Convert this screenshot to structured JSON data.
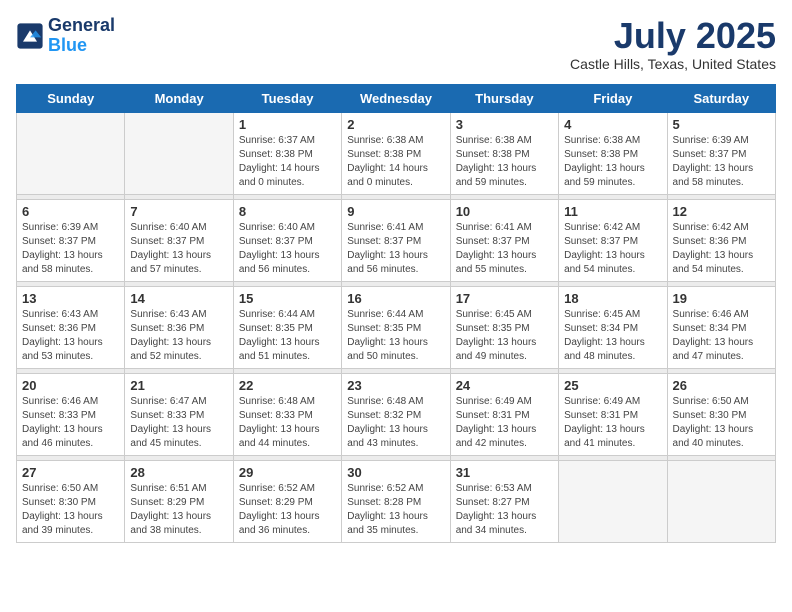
{
  "header": {
    "logo_line1": "General",
    "logo_line2": "Blue",
    "month_title": "July 2025",
    "location": "Castle Hills, Texas, United States"
  },
  "weekdays": [
    "Sunday",
    "Monday",
    "Tuesday",
    "Wednesday",
    "Thursday",
    "Friday",
    "Saturday"
  ],
  "weeks": [
    [
      {
        "day": "",
        "info": ""
      },
      {
        "day": "",
        "info": ""
      },
      {
        "day": "1",
        "info": "Sunrise: 6:37 AM\nSunset: 8:38 PM\nDaylight: 14 hours\nand 0 minutes."
      },
      {
        "day": "2",
        "info": "Sunrise: 6:38 AM\nSunset: 8:38 PM\nDaylight: 14 hours\nand 0 minutes."
      },
      {
        "day": "3",
        "info": "Sunrise: 6:38 AM\nSunset: 8:38 PM\nDaylight: 13 hours\nand 59 minutes."
      },
      {
        "day": "4",
        "info": "Sunrise: 6:38 AM\nSunset: 8:38 PM\nDaylight: 13 hours\nand 59 minutes."
      },
      {
        "day": "5",
        "info": "Sunrise: 6:39 AM\nSunset: 8:37 PM\nDaylight: 13 hours\nand 58 minutes."
      }
    ],
    [
      {
        "day": "6",
        "info": "Sunrise: 6:39 AM\nSunset: 8:37 PM\nDaylight: 13 hours\nand 58 minutes."
      },
      {
        "day": "7",
        "info": "Sunrise: 6:40 AM\nSunset: 8:37 PM\nDaylight: 13 hours\nand 57 minutes."
      },
      {
        "day": "8",
        "info": "Sunrise: 6:40 AM\nSunset: 8:37 PM\nDaylight: 13 hours\nand 56 minutes."
      },
      {
        "day": "9",
        "info": "Sunrise: 6:41 AM\nSunset: 8:37 PM\nDaylight: 13 hours\nand 56 minutes."
      },
      {
        "day": "10",
        "info": "Sunrise: 6:41 AM\nSunset: 8:37 PM\nDaylight: 13 hours\nand 55 minutes."
      },
      {
        "day": "11",
        "info": "Sunrise: 6:42 AM\nSunset: 8:37 PM\nDaylight: 13 hours\nand 54 minutes."
      },
      {
        "day": "12",
        "info": "Sunrise: 6:42 AM\nSunset: 8:36 PM\nDaylight: 13 hours\nand 54 minutes."
      }
    ],
    [
      {
        "day": "13",
        "info": "Sunrise: 6:43 AM\nSunset: 8:36 PM\nDaylight: 13 hours\nand 53 minutes."
      },
      {
        "day": "14",
        "info": "Sunrise: 6:43 AM\nSunset: 8:36 PM\nDaylight: 13 hours\nand 52 minutes."
      },
      {
        "day": "15",
        "info": "Sunrise: 6:44 AM\nSunset: 8:35 PM\nDaylight: 13 hours\nand 51 minutes."
      },
      {
        "day": "16",
        "info": "Sunrise: 6:44 AM\nSunset: 8:35 PM\nDaylight: 13 hours\nand 50 minutes."
      },
      {
        "day": "17",
        "info": "Sunrise: 6:45 AM\nSunset: 8:35 PM\nDaylight: 13 hours\nand 49 minutes."
      },
      {
        "day": "18",
        "info": "Sunrise: 6:45 AM\nSunset: 8:34 PM\nDaylight: 13 hours\nand 48 minutes."
      },
      {
        "day": "19",
        "info": "Sunrise: 6:46 AM\nSunset: 8:34 PM\nDaylight: 13 hours\nand 47 minutes."
      }
    ],
    [
      {
        "day": "20",
        "info": "Sunrise: 6:46 AM\nSunset: 8:33 PM\nDaylight: 13 hours\nand 46 minutes."
      },
      {
        "day": "21",
        "info": "Sunrise: 6:47 AM\nSunset: 8:33 PM\nDaylight: 13 hours\nand 45 minutes."
      },
      {
        "day": "22",
        "info": "Sunrise: 6:48 AM\nSunset: 8:33 PM\nDaylight: 13 hours\nand 44 minutes."
      },
      {
        "day": "23",
        "info": "Sunrise: 6:48 AM\nSunset: 8:32 PM\nDaylight: 13 hours\nand 43 minutes."
      },
      {
        "day": "24",
        "info": "Sunrise: 6:49 AM\nSunset: 8:31 PM\nDaylight: 13 hours\nand 42 minutes."
      },
      {
        "day": "25",
        "info": "Sunrise: 6:49 AM\nSunset: 8:31 PM\nDaylight: 13 hours\nand 41 minutes."
      },
      {
        "day": "26",
        "info": "Sunrise: 6:50 AM\nSunset: 8:30 PM\nDaylight: 13 hours\nand 40 minutes."
      }
    ],
    [
      {
        "day": "27",
        "info": "Sunrise: 6:50 AM\nSunset: 8:30 PM\nDaylight: 13 hours\nand 39 minutes."
      },
      {
        "day": "28",
        "info": "Sunrise: 6:51 AM\nSunset: 8:29 PM\nDaylight: 13 hours\nand 38 minutes."
      },
      {
        "day": "29",
        "info": "Sunrise: 6:52 AM\nSunset: 8:29 PM\nDaylight: 13 hours\nand 36 minutes."
      },
      {
        "day": "30",
        "info": "Sunrise: 6:52 AM\nSunset: 8:28 PM\nDaylight: 13 hours\nand 35 minutes."
      },
      {
        "day": "31",
        "info": "Sunrise: 6:53 AM\nSunset: 8:27 PM\nDaylight: 13 hours\nand 34 minutes."
      },
      {
        "day": "",
        "info": ""
      },
      {
        "day": "",
        "info": ""
      }
    ]
  ]
}
